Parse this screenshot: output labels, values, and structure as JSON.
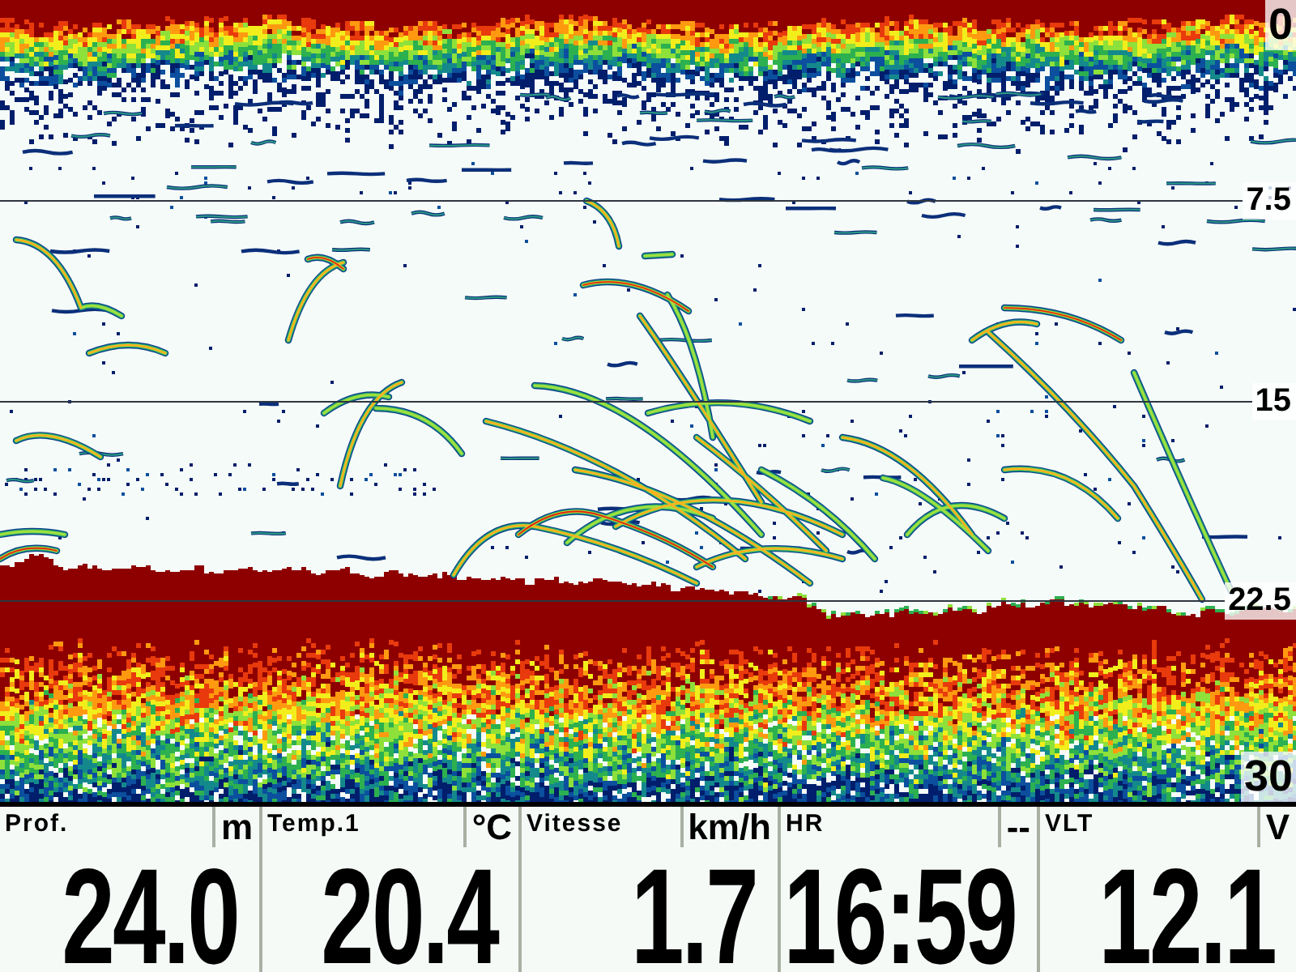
{
  "sonar": {
    "depth_scale": [
      "0",
      "7.5",
      "15",
      "22.5",
      "30"
    ]
  },
  "readouts": [
    {
      "label": "Prof.",
      "unit": "m",
      "value": "24.0"
    },
    {
      "label": "Temp.1",
      "unit": "°C",
      "value": "20.4"
    },
    {
      "label": "Vitesse",
      "unit": "km/h",
      "value": "1.7"
    },
    {
      "label": "HR",
      "unit": "--",
      "value": "16:59"
    },
    {
      "label": "VLT",
      "unit": "V",
      "value": "12.1"
    }
  ]
}
